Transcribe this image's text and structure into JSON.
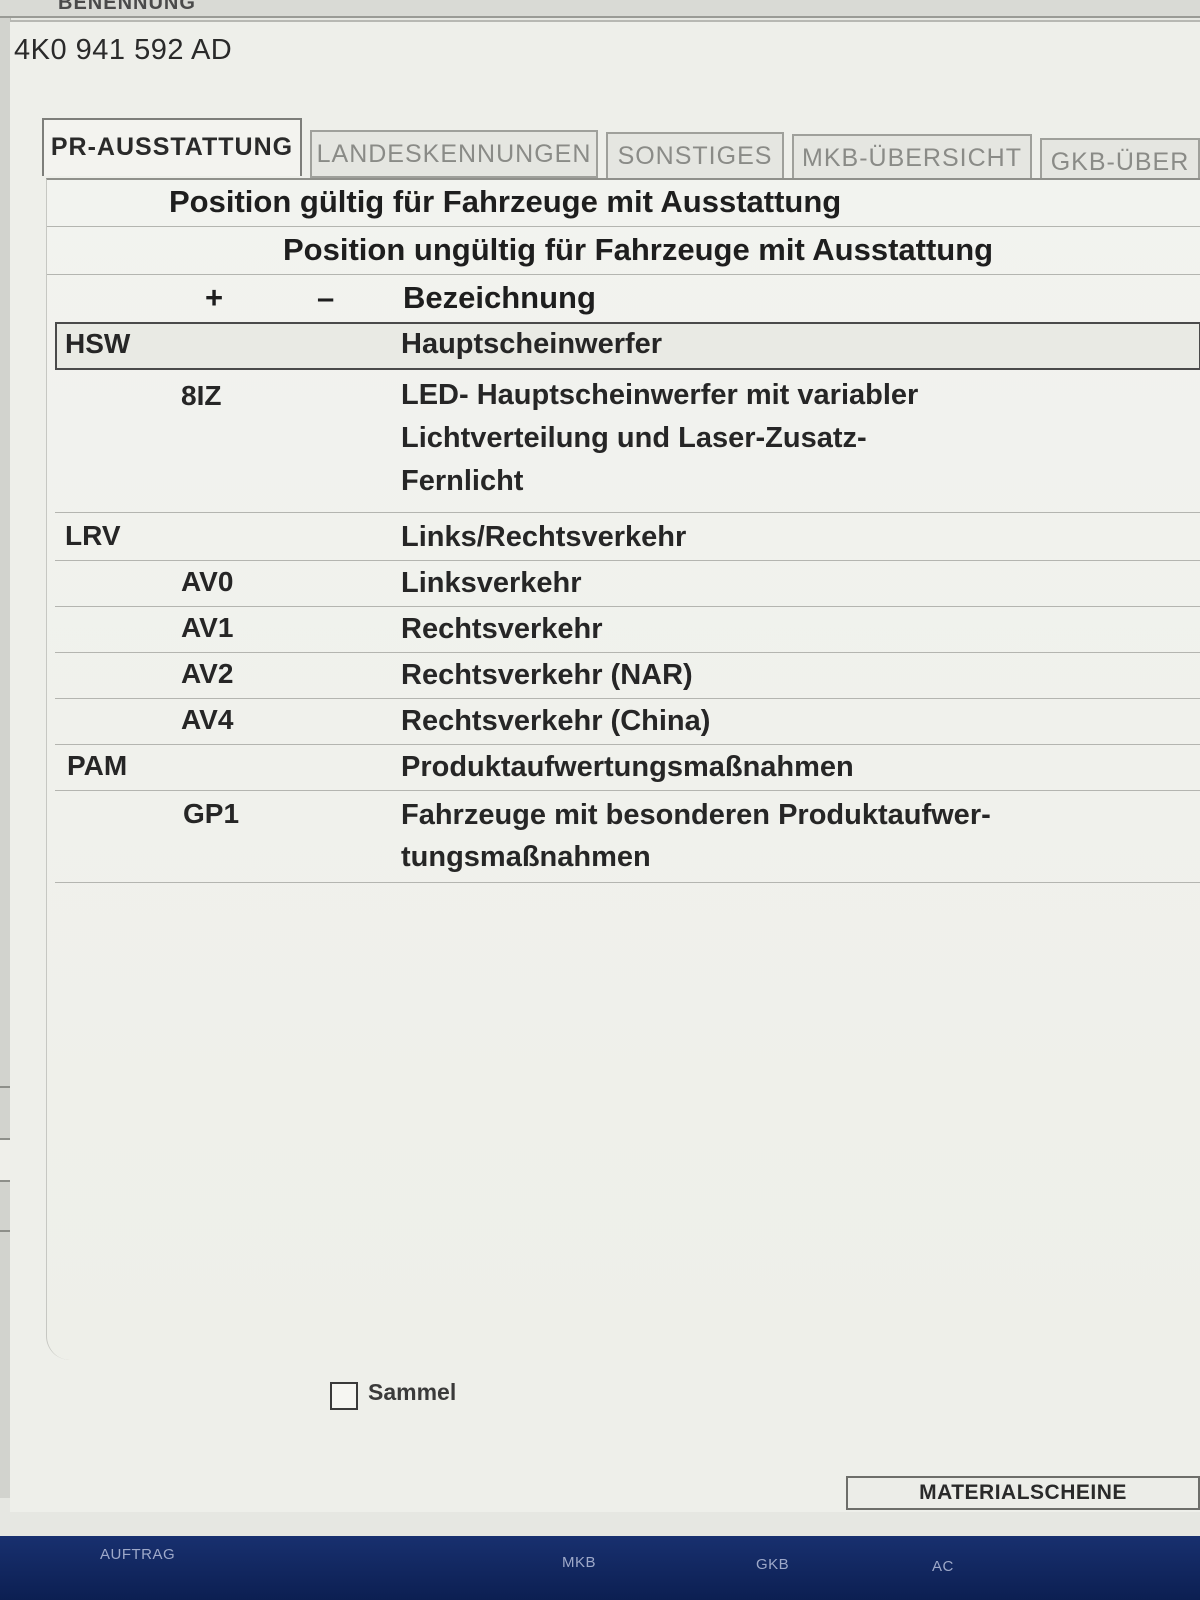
{
  "top_strip_label": "BENENNUNG",
  "part_number": "4K0 941 592 AD",
  "tabs": [
    {
      "label": "PR-AUSSTATTUNG",
      "active": true
    },
    {
      "label": "LANDESKENNUNGEN",
      "active": false
    },
    {
      "label": "SONSTIGES",
      "active": false
    },
    {
      "label": "MKB-ÜBERSICHT",
      "active": false
    },
    {
      "label": "GKB-ÜBER",
      "active": false
    }
  ],
  "table": {
    "header_valid": "Position gültig für Fahrzeuge mit Ausstattung",
    "header_invalid": "Position ungültig für Fahrzeuge mit Ausstattung",
    "col_plus": "+",
    "col_minus": "–",
    "col_desc": "Bezeichnung",
    "rows": [
      {
        "group": "HSW",
        "code": "",
        "desc": [
          "Hauptscheinwerfer"
        ],
        "selected": true
      },
      {
        "group": "",
        "code": "8IZ",
        "desc": [
          "LED- Hauptscheinwerfer mit variabler",
          "Lichtverteilung und Laser-Zusatz-",
          "Fernlicht"
        ],
        "selected": false
      },
      {
        "group": "LRV",
        "code": "",
        "desc": [
          "Links/Rechtsverkehr"
        ],
        "selected": false
      },
      {
        "group": "",
        "code": "AV0",
        "desc": [
          "Linksverkehr"
        ],
        "selected": false
      },
      {
        "group": "",
        "code": "AV1",
        "desc": [
          "Rechtsverkehr"
        ],
        "selected": false
      },
      {
        "group": "",
        "code": "AV2",
        "desc": [
          "Rechtsverkehr (NAR)"
        ],
        "selected": false
      },
      {
        "group": "",
        "code": "AV4",
        "desc": [
          "Rechtsverkehr (China)"
        ],
        "selected": false
      },
      {
        "group": "PAM",
        "code": "",
        "desc": [
          "Produktaufwertungsmaßnahmen"
        ],
        "selected": false
      },
      {
        "group": "",
        "code": "GP1",
        "desc": [
          "Fahrzeuge mit besonderen Produktaufwer-",
          "tungsmaßnahmen"
        ],
        "selected": false
      }
    ]
  },
  "sammel_label": "Sammel",
  "sammel_checked": false,
  "material_button_label": "MATERIALSCHEINE",
  "bottom_nav": [
    "AUFTRAG",
    "MKB",
    "GKB",
    "AC"
  ],
  "side_handle_glyph": "in",
  "colors": {
    "nav_background": "#12285f",
    "panel_background": "#f2f3ef"
  }
}
